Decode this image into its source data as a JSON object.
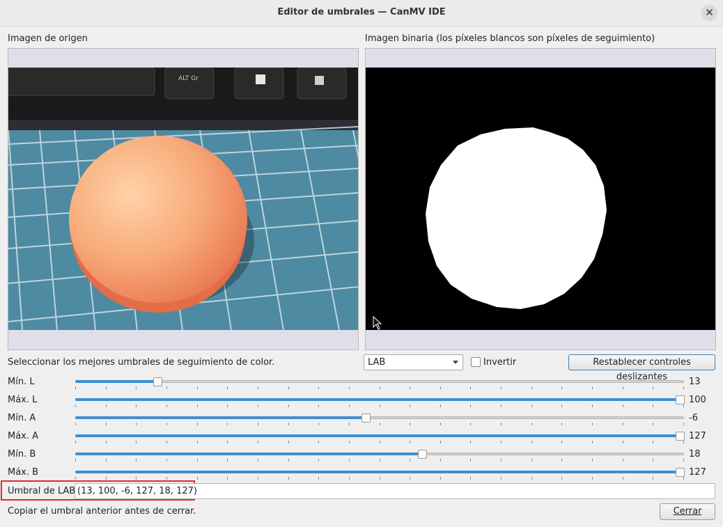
{
  "window": {
    "title": "Editor de umbrales — CanMV IDE"
  },
  "source": {
    "label": "Imagen de origen"
  },
  "binary": {
    "label": "Imagen binaria (los píxeles blancos son píxeles de seguimiento)"
  },
  "controls": {
    "instruction": "Seleccionar los mejores umbrales de seguimiento de color.",
    "colorspace": "LAB",
    "invert_label": "Invertir",
    "invert_checked": false,
    "reset_label": "Restablecer controles deslizantes"
  },
  "sliders": [
    {
      "label": "Mín. L",
      "value": "13",
      "fraction": 0.13
    },
    {
      "label": "Máx. L",
      "value": "100",
      "fraction": 1.0
    },
    {
      "label": "Mín. A",
      "value": "-6",
      "fraction": 0.477
    },
    {
      "label": "Máx. A",
      "value": "127",
      "fraction": 1.0
    },
    {
      "label": "Mín. B",
      "value": "18",
      "fraction": 0.571
    },
    {
      "label": "Máx. B",
      "value": "127",
      "fraction": 1.0
    }
  ],
  "threshold": {
    "label": "Umbral de LAB",
    "value": "(13, 100, -6, 127, 18, 127)"
  },
  "footer": {
    "hint": "Copiar el umbral anterior antes de cerrar.",
    "close_label": "Cerrar"
  },
  "colors": {
    "accent": "#3d8fd1",
    "highlight": "#e02b2b",
    "orange_object": "#f29a67",
    "mat": "#4f8da3"
  },
  "icons": [
    "close-icon",
    "dropdown-arrow-icon",
    "mouse-cursor-icon"
  ]
}
